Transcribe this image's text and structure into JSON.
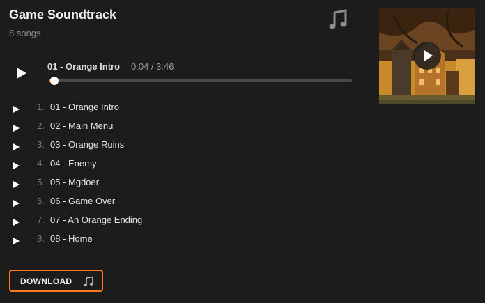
{
  "header": {
    "title": "Game Soundtrack",
    "song_count": "8 songs",
    "icon": "music-note-icon"
  },
  "player": {
    "now_playing": "01 - Orange Intro",
    "time": "0:04 / 3:46",
    "progress_fraction": 0.018,
    "accent_color": "#ff7a1a"
  },
  "tracks": [
    {
      "num": "1.",
      "name": "01 - Orange Intro"
    },
    {
      "num": "2.",
      "name": "02 - Main Menu"
    },
    {
      "num": "3.",
      "name": "03 - Orange Ruins"
    },
    {
      "num": "4.",
      "name": "04 - Enemy"
    },
    {
      "num": "5.",
      "name": "05 - Mgdoer"
    },
    {
      "num": "6.",
      "name": "06 - Game Over"
    },
    {
      "num": "7.",
      "name": "07 - An Orange Ending"
    },
    {
      "num": "8.",
      "name": "08 - Home"
    }
  ],
  "download": {
    "label": "DOWNLOAD",
    "icon": "music-note-icon",
    "border_color": "#ff7a1a"
  },
  "cover": {
    "icon": "play-icon"
  }
}
